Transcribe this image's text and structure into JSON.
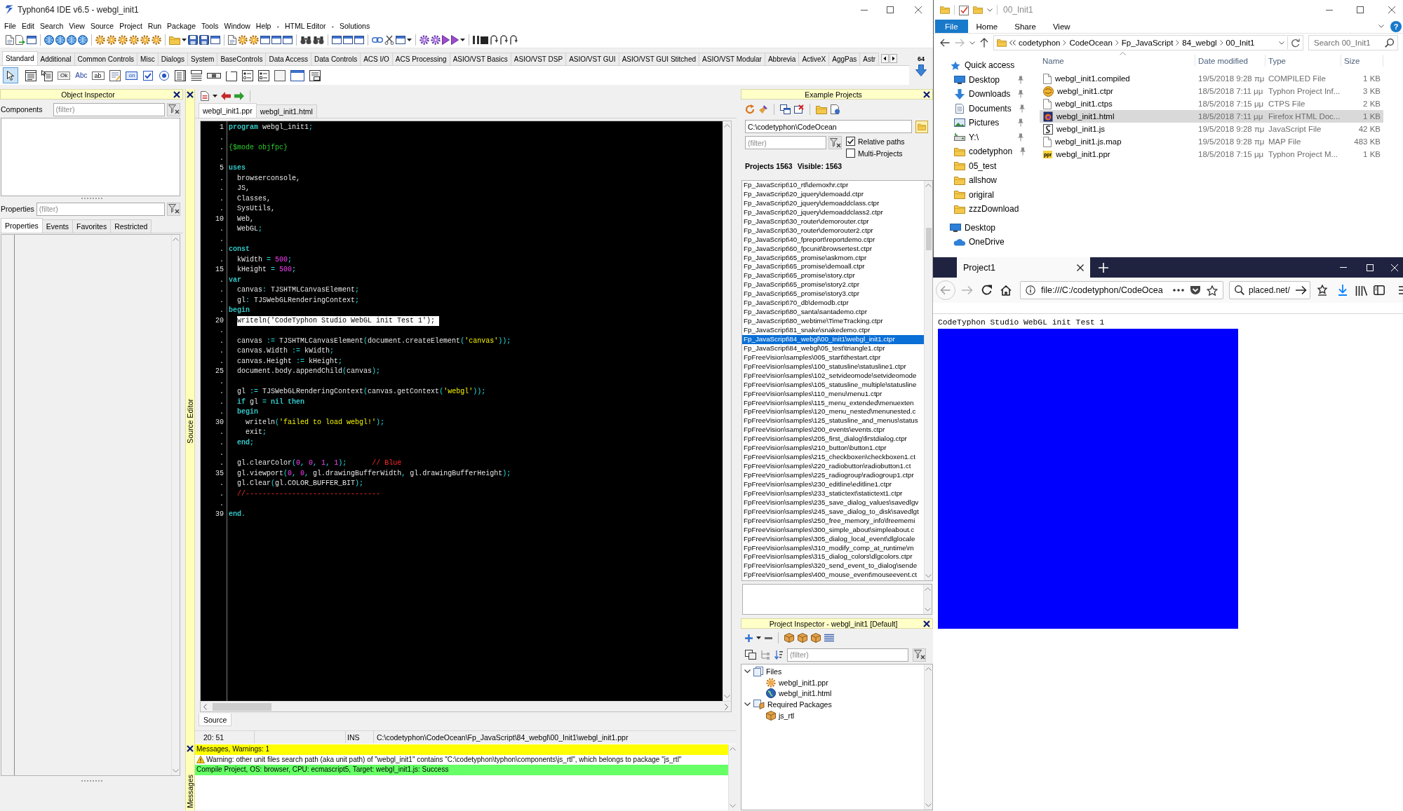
{
  "ide": {
    "title": "Typhon64 IDE v6.5 - webgl_init1",
    "menu": [
      "File",
      "Edit",
      "Search",
      "View",
      "Source",
      "Project",
      "Run",
      "Package",
      "Tools",
      "Window",
      "Help",
      "-",
      "HTML Editor",
      "-",
      "Solutions"
    ],
    "palette": {
      "tabs": [
        {
          "label": "Standard",
          "selected": true
        },
        {
          "label": "Additional",
          "selected": false
        },
        {
          "label": "Common Controls",
          "selected": false
        },
        {
          "label": "Misc",
          "selected": false
        },
        {
          "label": "Dialogs",
          "selected": false
        },
        {
          "label": "System",
          "selected": false
        },
        {
          "label": "BaseControls",
          "selected": false
        },
        {
          "label": "Data Access",
          "selected": false
        },
        {
          "label": "Data Controls",
          "selected": false
        },
        {
          "label": "ACS I/O",
          "selected": false
        },
        {
          "label": "ACS Processing",
          "selected": false
        },
        {
          "label": "ASIO/VST Basics",
          "selected": false
        },
        {
          "label": "ASIO/VST DSP",
          "selected": false
        },
        {
          "label": "ASIO/VST GUI",
          "selected": false
        },
        {
          "label": "ASIO/VST GUI Stitched",
          "selected": false
        },
        {
          "label": "ASIO/VST Modular",
          "selected": false
        },
        {
          "label": "Abbrevia",
          "selected": false
        },
        {
          "label": "ActiveX",
          "selected": false
        },
        {
          "label": "AggPas",
          "selected": false
        },
        {
          "label": "Astr",
          "selected": false
        }
      ],
      "components": [
        {
          "kind": "pointer",
          "selected": true
        },
        {
          "kind": "main_menu",
          "selected": false
        },
        {
          "kind": "popup_menu",
          "selected": false
        },
        {
          "kind": "button",
          "glyph": "Ok",
          "selected": false
        },
        {
          "kind": "label",
          "glyph": "Abc",
          "selected": false
        },
        {
          "kind": "edit",
          "glyph": "ab",
          "selected": false
        },
        {
          "kind": "memo",
          "selected": false
        },
        {
          "kind": "toggle",
          "glyph": "on",
          "selected": false
        },
        {
          "kind": "checkbox",
          "selected": false
        },
        {
          "kind": "radio",
          "selected": false
        },
        {
          "kind": "listbox",
          "selected": false
        },
        {
          "kind": "combobox",
          "selected": false
        },
        {
          "kind": "scrollbar",
          "selected": false
        },
        {
          "kind": "groupbox",
          "selected": false
        },
        {
          "kind": "radiogroup",
          "selected": false
        },
        {
          "kind": "checkgroup",
          "selected": false
        },
        {
          "kind": "panel",
          "selected": false
        },
        {
          "kind": "frame",
          "selected": false
        },
        {
          "kind": "actionlist",
          "selected": false
        }
      ],
      "corner_label": "64"
    },
    "object_inspector": {
      "title": "Object Inspector",
      "components_label": "Components",
      "components_filter": {
        "placeholder": "(filter)"
      },
      "properties_label": "Properties",
      "properties_filter": {
        "placeholder": "(filter)"
      },
      "tabs": [
        {
          "label": "Properties",
          "selected": true
        },
        {
          "label": "Events",
          "selected": false
        },
        {
          "label": "Favorites",
          "selected": false
        },
        {
          "label": "Restricted",
          "selected": false
        }
      ]
    },
    "source_editor": {
      "side_label": "Source Editor",
      "tabs": [
        {
          "label": "webgl_init1.ppr",
          "selected": true
        },
        {
          "label": "webgl_init1.html",
          "selected": false
        }
      ],
      "lines": [
        {
          "gutter": "1",
          "highlighted": false,
          "tokens": [
            {
              "kind": "keyword",
              "text": "program"
            },
            {
              "kind": "text",
              "text": " webgl_init1"
            },
            {
              "kind": "symbol",
              "text": ";"
            }
          ]
        },
        {
          "gutter": "."
        },
        {
          "gutter": ".",
          "highlighted": false,
          "tokens": [
            {
              "kind": "directive",
              "text": "{$mode objfpc}"
            }
          ]
        },
        {
          "gutter": "."
        },
        {
          "gutter": "5",
          "highlighted": false,
          "tokens": [
            {
              "kind": "keyword",
              "text": "uses"
            }
          ]
        },
        {
          "gutter": ".",
          "highlighted": false,
          "tokens": [
            {
              "kind": "text",
              "text": "  browserconsole,"
            }
          ]
        },
        {
          "gutter": ".",
          "highlighted": false,
          "tokens": [
            {
              "kind": "text",
              "text": "  JS,"
            }
          ]
        },
        {
          "gutter": ".",
          "highlighted": false,
          "tokens": [
            {
              "kind": "text",
              "text": "  Classes,"
            }
          ]
        },
        {
          "gutter": ".",
          "highlighted": false,
          "tokens": [
            {
              "kind": "text",
              "text": "  SysUtils,"
            }
          ]
        },
        {
          "gutter": "10",
          "highlighted": false,
          "tokens": [
            {
              "kind": "text",
              "text": "  Web,"
            }
          ]
        },
        {
          "gutter": ".",
          "highlighted": false,
          "tokens": [
            {
              "kind": "text",
              "text": "  WebGL"
            },
            {
              "kind": "symbol",
              "text": ";"
            }
          ]
        },
        {
          "gutter": "."
        },
        {
          "gutter": ".",
          "highlighted": false,
          "tokens": [
            {
              "kind": "keyword",
              "text": "const"
            }
          ]
        },
        {
          "gutter": ".",
          "highlighted": false,
          "tokens": [
            {
              "kind": "text",
              "text": "  kWidth "
            },
            {
              "kind": "symbol",
              "text": "= "
            },
            {
              "kind": "number",
              "text": "500"
            },
            {
              "kind": "symbol",
              "text": ";"
            }
          ]
        },
        {
          "gutter": "15",
          "highlighted": false,
          "tokens": [
            {
              "kind": "text",
              "text": "  kHeight "
            },
            {
              "kind": "symbol",
              "text": "= "
            },
            {
              "kind": "number",
              "text": "500"
            },
            {
              "kind": "symbol",
              "text": ";"
            }
          ]
        },
        {
          "gutter": ".",
          "highlighted": false,
          "tokens": [
            {
              "kind": "keyword",
              "text": "var"
            }
          ]
        },
        {
          "gutter": ".",
          "highlighted": false,
          "tokens": [
            {
              "kind": "text",
              "text": "  canvas"
            },
            {
              "kind": "symbol",
              "text": ":"
            },
            {
              "kind": "text",
              "text": " TJSHTMLCanvasElement"
            },
            {
              "kind": "symbol",
              "text": ";"
            }
          ]
        },
        {
          "gutter": ".",
          "highlighted": false,
          "tokens": [
            {
              "kind": "text",
              "text": "  gl"
            },
            {
              "kind": "symbol",
              "text": ":"
            },
            {
              "kind": "text",
              "text": " TJSWebGLRenderingContext"
            },
            {
              "kind": "symbol",
              "text": ";"
            }
          ]
        },
        {
          "gutter": ".",
          "highlighted": false,
          "tokens": [
            {
              "kind": "keyword",
              "text": "begin"
            }
          ]
        },
        {
          "gutter": "20",
          "highlighted": true,
          "tokens": [
            {
              "kind": "text",
              "text": "  writeln"
            },
            {
              "kind": "symbol",
              "text": "("
            },
            {
              "kind": "string",
              "text": "'CodeTyphon Studio WebGL init Test 1'"
            },
            {
              "kind": "symbol",
              "text": ");"
            }
          ]
        },
        {
          "gutter": "."
        },
        {
          "gutter": ".",
          "highlighted": false,
          "tokens": [
            {
              "kind": "text",
              "text": "  canvas "
            },
            {
              "kind": "symbol",
              "text": ":="
            },
            {
              "kind": "text",
              "text": " TJSHTMLCanvasElement"
            },
            {
              "kind": "symbol",
              "text": "("
            },
            {
              "kind": "text",
              "text": "document.createElement"
            },
            {
              "kind": "symbol",
              "text": "("
            },
            {
              "kind": "string",
              "text": "'canvas'"
            },
            {
              "kind": "symbol",
              "text": "));"
            }
          ]
        },
        {
          "gutter": ".",
          "highlighted": false,
          "tokens": [
            {
              "kind": "text",
              "text": "  canvas.Width "
            },
            {
              "kind": "symbol",
              "text": ":="
            },
            {
              "kind": "text",
              "text": " kWidth"
            },
            {
              "kind": "symbol",
              "text": ";"
            }
          ]
        },
        {
          "gutter": ".",
          "highlighted": false,
          "tokens": [
            {
              "kind": "text",
              "text": "  canvas.Height "
            },
            {
              "kind": "symbol",
              "text": ":="
            },
            {
              "kind": "text",
              "text": " kHeight"
            },
            {
              "kind": "symbol",
              "text": ";"
            }
          ]
        },
        {
          "gutter": "25",
          "highlighted": false,
          "tokens": [
            {
              "kind": "text",
              "text": "  document.body.appendChild"
            },
            {
              "kind": "symbol",
              "text": "("
            },
            {
              "kind": "text",
              "text": "canvas"
            },
            {
              "kind": "symbol",
              "text": ");"
            }
          ]
        },
        {
          "gutter": "."
        },
        {
          "gutter": ".",
          "highlighted": false,
          "tokens": [
            {
              "kind": "text",
              "text": "  gl "
            },
            {
              "kind": "symbol",
              "text": ":="
            },
            {
              "kind": "text",
              "text": " TJSWebGLRenderingContext"
            },
            {
              "kind": "symbol",
              "text": "("
            },
            {
              "kind": "text",
              "text": "canvas.getContext"
            },
            {
              "kind": "symbol",
              "text": "("
            },
            {
              "kind": "string",
              "text": "'webgl'"
            },
            {
              "kind": "symbol",
              "text": "));"
            }
          ]
        },
        {
          "gutter": ".",
          "highlighted": false,
          "tokens": [
            {
              "kind": "keyword",
              "text": "  if"
            },
            {
              "kind": "text",
              "text": " gl "
            },
            {
              "kind": "symbol",
              "text": "= "
            },
            {
              "kind": "keyword",
              "text": "nil then"
            }
          ]
        },
        {
          "gutter": ".",
          "highlighted": false,
          "tokens": [
            {
              "kind": "keyword",
              "text": "  begin"
            }
          ]
        },
        {
          "gutter": "30",
          "highlighted": false,
          "tokens": [
            {
              "kind": "text",
              "text": "    writeln"
            },
            {
              "kind": "symbol",
              "text": "("
            },
            {
              "kind": "string",
              "text": "'failed to load webgl!'"
            },
            {
              "kind": "symbol",
              "text": ");"
            }
          ]
        },
        {
          "gutter": ".",
          "highlighted": false,
          "tokens": [
            {
              "kind": "text",
              "text": "    exit"
            },
            {
              "kind": "symbol",
              "text": ";"
            }
          ]
        },
        {
          "gutter": ".",
          "highlighted": false,
          "tokens": [
            {
              "kind": "keyword",
              "text": "  end"
            },
            {
              "kind": "symbol",
              "text": ";"
            }
          ]
        },
        {
          "gutter": "."
        },
        {
          "gutter": ".",
          "highlighted": false,
          "tokens": [
            {
              "kind": "text",
              "text": "  gl.clearColor"
            },
            {
              "kind": "symbol",
              "text": "("
            },
            {
              "kind": "number",
              "text": "0"
            },
            {
              "kind": "symbol",
              "text": ", "
            },
            {
              "kind": "number",
              "text": "0"
            },
            {
              "kind": "symbol",
              "text": ", "
            },
            {
              "kind": "number",
              "text": "1"
            },
            {
              "kind": "symbol",
              "text": ", "
            },
            {
              "kind": "number",
              "text": "1"
            },
            {
              "kind": "symbol",
              "text": ");      "
            },
            {
              "kind": "comment",
              "text": "// Blue"
            }
          ]
        },
        {
          "gutter": "35",
          "highlighted": false,
          "tokens": [
            {
              "kind": "text",
              "text": "  gl.viewport"
            },
            {
              "kind": "symbol",
              "text": "("
            },
            {
              "kind": "number",
              "text": "0"
            },
            {
              "kind": "symbol",
              "text": ", "
            },
            {
              "kind": "number",
              "text": "0"
            },
            {
              "kind": "symbol",
              "text": ", "
            },
            {
              "kind": "text",
              "text": "gl.drawingBufferWidth"
            },
            {
              "kind": "symbol",
              "text": ", "
            },
            {
              "kind": "text",
              "text": "gl.drawingBufferHeight"
            },
            {
              "kind": "symbol",
              "text": ");"
            }
          ]
        },
        {
          "gutter": ".",
          "highlighted": false,
          "tokens": [
            {
              "kind": "text",
              "text": "  gl.Clear"
            },
            {
              "kind": "symbol",
              "text": "("
            },
            {
              "kind": "text",
              "text": "gl.COLOR_BUFFER_BIT"
            },
            {
              "kind": "symbol",
              "text": ");"
            }
          ]
        },
        {
          "gutter": ".",
          "highlighted": false,
          "tokens": [
            {
              "kind": "comment",
              "text": "  //--------------------------------"
            }
          ]
        },
        {
          "gutter": "."
        },
        {
          "gutter": "39",
          "highlighted": false,
          "tokens": [
            {
              "kind": "keyword",
              "text": "end"
            },
            {
              "kind": "symbol",
              "text": "."
            }
          ]
        }
      ],
      "bottom_tabs": [
        {
          "label": "Source",
          "selected": true
        }
      ],
      "status": {
        "position": "20: 51",
        "mode": "INS",
        "file": "C:\\codetyphon\\CodeOcean\\Fp_JavaScript\\84_webgl\\00_Init1\\webgl_init1.ppr"
      }
    },
    "messages": {
      "side_label": "Messages",
      "rows": [
        {
          "kind": "header",
          "text": "Messages, Warnings: 1"
        },
        {
          "kind": "warning",
          "text": "Warning: other unit files search path (aka unit path) of \"webgl_init1\" contains \"C:\\codetyphon\\typhon\\components\\js_rtl\", which belongs to package \"js_rtl\""
        },
        {
          "kind": "success",
          "text": "Compile Project, OS: browser, CPU: ecmascript5, Target: webgl_init1.js: Success"
        }
      ]
    },
    "example_projects": {
      "title": "Example Projects",
      "path": "C:\\codetyphon\\CodeOcean",
      "filter": {
        "placeholder": "(filter)"
      },
      "options": [
        {
          "label": "Relative paths",
          "checked": true
        },
        {
          "label": "Multi-Projects",
          "checked": false
        }
      ],
      "count": "Projects 1563",
      "visible": "Visible: 1563",
      "projects": [
        {
          "path": "Fp_JavaScript\\10_rtl\\demoxhr.ctpr",
          "selected": false
        },
        {
          "path": "Fp_JavaScript\\20_jquery\\demoadd.ctpr",
          "selected": false
        },
        {
          "path": "Fp_JavaScript\\20_jquery\\demoaddclass.ctpr",
          "selected": false
        },
        {
          "path": "Fp_JavaScript\\20_jquery\\demoaddclass2.ctpr",
          "selected": false
        },
        {
          "path": "Fp_JavaScript\\30_router\\demorouter.ctpr",
          "selected": false
        },
        {
          "path": "Fp_JavaScript\\30_router\\demorouter2.ctpr",
          "selected": false
        },
        {
          "path": "Fp_JavaScript\\40_fpreport\\reportdemo.ctpr",
          "selected": false
        },
        {
          "path": "Fp_JavaScript\\60_fpcunit\\browsertest.ctpr",
          "selected": false
        },
        {
          "path": "Fp_JavaScript\\65_promise\\askmom.ctpr",
          "selected": false
        },
        {
          "path": "Fp_JavaScript\\65_promise\\demoall.ctpr",
          "selected": false
        },
        {
          "path": "Fp_JavaScript\\65_promise\\story.ctpr",
          "selected": false
        },
        {
          "path": "Fp_JavaScript\\65_promise\\story2.ctpr",
          "selected": false
        },
        {
          "path": "Fp_JavaScript\\65_promise\\story3.ctpr",
          "selected": false
        },
        {
          "path": "Fp_JavaScript\\70_db\\demodb.ctpr",
          "selected": false
        },
        {
          "path": "Fp_JavaScript\\80_santa\\santademo.ctpr",
          "selected": false
        },
        {
          "path": "Fp_JavaScript\\80_webtime\\TimeTracking.ctpr",
          "selected": false
        },
        {
          "path": "Fp_JavaScript\\81_snake\\snakedemo.ctpr",
          "selected": false
        },
        {
          "path": "Fp_JavaScript\\84_webgl\\00_Init1\\webgl_init1.ctpr",
          "selected": true
        },
        {
          "path": "Fp_JavaScript\\84_webgl\\05_test\\triangle1.ctpr",
          "selected": false
        },
        {
          "path": "FpFreeVision\\samples\\005_start\\thestart.ctpr",
          "selected": false
        },
        {
          "path": "FpFreeVision\\samples\\100_statusline\\statusline1.ctpr",
          "selected": false
        },
        {
          "path": "FpFreeVision\\samples\\102_setvideomode\\setvideomode",
          "selected": false
        },
        {
          "path": "FpFreeVision\\samples\\105_statusline_multiple\\statusline",
          "selected": false
        },
        {
          "path": "FpFreeVision\\samples\\110_menu\\menu1.ctpr",
          "selected": false
        },
        {
          "path": "FpFreeVision\\samples\\115_menu_extended\\menuexten",
          "selected": false
        },
        {
          "path": "FpFreeVision\\samples\\120_menu_nested\\menunested.c",
          "selected": false
        },
        {
          "path": "FpFreeVision\\samples\\125_statusline_and_menus\\status",
          "selected": false
        },
        {
          "path": "FpFreeVision\\samples\\200_events\\events.ctpr",
          "selected": false
        },
        {
          "path": "FpFreeVision\\samples\\205_first_dialog\\firstdialog.ctpr",
          "selected": false
        },
        {
          "path": "FpFreeVision\\samples\\210_button\\button1.ctpr",
          "selected": false
        },
        {
          "path": "FpFreeVision\\samples\\215_checkboxen\\checkboxen1.ct",
          "selected": false
        },
        {
          "path": "FpFreeVision\\samples\\220_radiobutton\\radiobutton1.ct",
          "selected": false
        },
        {
          "path": "FpFreeVision\\samples\\225_radiogroup\\radiogroup1.ctpr",
          "selected": false
        },
        {
          "path": "FpFreeVision\\samples\\230_editline\\editline1.ctpr",
          "selected": false
        },
        {
          "path": "FpFreeVision\\samples\\233_statictext\\statictext1.ctpr",
          "selected": false
        },
        {
          "path": "FpFreeVision\\samples\\235_save_dialog_values\\savedlgv",
          "selected": false
        },
        {
          "path": "FpFreeVision\\samples\\245_save_dialog_to_disk\\savedlgt",
          "selected": false
        },
        {
          "path": "FpFreeVision\\samples\\250_free_memory_info\\freememi",
          "selected": false
        },
        {
          "path": "FpFreeVision\\samples\\300_simple_about\\simpleabout.c",
          "selected": false
        },
        {
          "path": "FpFreeVision\\samples\\305_dialog_local_event\\dlglocale",
          "selected": false
        },
        {
          "path": "FpFreeVision\\samples\\310_modify_comp_at_runtime\\m",
          "selected": false
        },
        {
          "path": "FpFreeVision\\samples\\315_dialog_colors\\dlgcolors.ctpr",
          "selected": false
        },
        {
          "path": "FpFreeVision\\samples\\320_send_event_to_dialog\\sende",
          "selected": false
        },
        {
          "path": "FpFreeVision\\samples\\400_mouse_event\\mouseevent.ct",
          "selected": false
        }
      ]
    },
    "project_inspector": {
      "title": "Project Inspector - webgl_init1 [Default]",
      "filter": {
        "placeholder": "(filter)"
      },
      "tree": [
        {
          "label": "Files",
          "kind": "files",
          "expanded": true,
          "children": [
            {
              "label": "webgl_init1.ppr",
              "kind": "program"
            },
            {
              "label": "webgl_init1.html",
              "kind": "web"
            }
          ]
        },
        {
          "label": "Required Packages",
          "kind": "packages",
          "expanded": true,
          "children": [
            {
              "label": "js_rtl",
              "kind": "package"
            }
          ]
        }
      ]
    }
  },
  "explorer": {
    "title": "00_Init1",
    "ribbon": [
      {
        "label": "File",
        "kind": "menu"
      },
      {
        "label": "Home",
        "kind": "tab"
      },
      {
        "label": "Share",
        "kind": "tab"
      },
      {
        "label": "View",
        "kind": "tab"
      }
    ],
    "help": "?",
    "breadcrumb": [
      "codetyphon",
      "CodeOcean",
      "Fp_JavaScript",
      "84_webgl",
      "00_Init1"
    ],
    "search": {
      "placeholder": "Search 00_Init1"
    },
    "nav": [
      {
        "label": "Quick access",
        "kind": "star",
        "children": [
          {
            "label": "Desktop",
            "kind": "desktop",
            "pinned": true
          },
          {
            "label": "Downloads",
            "kind": "download",
            "pinned": true
          },
          {
            "label": "Documents",
            "kind": "documents",
            "pinned": true
          },
          {
            "label": "Pictures",
            "kind": "pictures",
            "pinned": true
          },
          {
            "label": "Y:\\",
            "kind": "drive",
            "pinned": true
          },
          {
            "label": "codetyphon",
            "kind": "folder",
            "pinned": true
          },
          {
            "label": "05_test",
            "kind": "folder",
            "pinned": false
          },
          {
            "label": "allshow",
            "kind": "folder",
            "pinned": false
          },
          {
            "label": "origiral",
            "kind": "folder",
            "pinned": false
          },
          {
            "label": "zzzDownload",
            "kind": "folder",
            "pinned": false
          }
        ]
      },
      {
        "label": "Desktop",
        "kind": "desktop",
        "children": [
          {
            "label": "OneDrive",
            "kind": "cloud"
          }
        ]
      }
    ],
    "columns": [
      "Name",
      "Date modified",
      "Type",
      "Size"
    ],
    "files": [
      {
        "name": "webgl_init1.compiled",
        "date": "19/5/2018 9:28 πμ",
        "type": "COMPILED File",
        "size": "1 KB",
        "kind": "blank",
        "selected": false
      },
      {
        "name": "webgl_init1.ctpr",
        "date": "18/5/2018 7:11 μμ",
        "type": "Typhon Project Inf...",
        "size": "3 KB",
        "kind": "round",
        "selected": false
      },
      {
        "name": "webgl_init1.ctps",
        "date": "18/5/2018 7:15 μμ",
        "type": "CTPS File",
        "size": "2 KB",
        "kind": "blank",
        "selected": false
      },
      {
        "name": "webgl_init1.html",
        "date": "18/5/2018 7:11 μμ",
        "type": "Firefox HTML Doc...",
        "size": "1 KB",
        "kind": "tile",
        "selected": true
      },
      {
        "name": "webgl_init1.js",
        "date": "19/5/2018 9:28 πμ",
        "type": "JavaScript File",
        "size": "42 KB",
        "kind": "script",
        "selected": false
      },
      {
        "name": "webgl_init1.js.map",
        "date": "19/5/2018 9:28 πμ",
        "type": "MAP File",
        "size": "483 KB",
        "kind": "blank",
        "selected": false
      },
      {
        "name": "webgl_init1.ppr",
        "date": "18/5/2018 7:15 μμ",
        "type": "Typhon Project M...",
        "size": "1 KB",
        "kind": "badge",
        "badge": "ppr",
        "selected": false
      }
    ]
  },
  "browser": {
    "tabs": [
      {
        "label": "Project1",
        "selected": true
      }
    ],
    "url": "file:///C:/codetyphon/CodeOcea",
    "search": "placed.net/",
    "page_text": "CodeTyphon Studio WebGL init Test 1"
  }
}
